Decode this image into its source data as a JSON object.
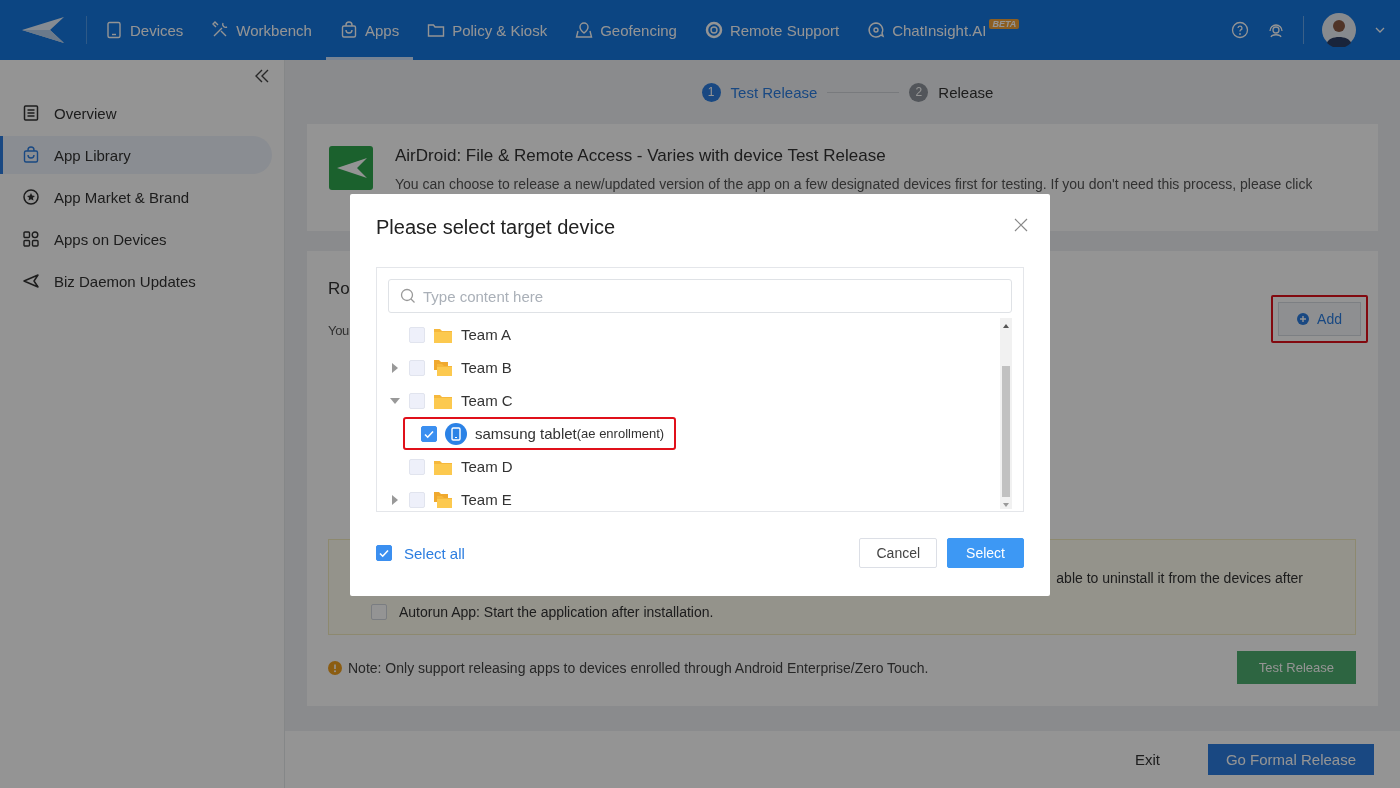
{
  "header": {
    "nav": [
      {
        "label": "Devices",
        "selected": false
      },
      {
        "label": "Workbench",
        "selected": false
      },
      {
        "label": "Apps",
        "selected": true
      },
      {
        "label": "Policy & Kiosk",
        "selected": false
      },
      {
        "label": "Geofencing",
        "selected": false
      },
      {
        "label": "Remote Support",
        "selected": false
      },
      {
        "label": "ChatInsight.AI",
        "selected": false,
        "badge": "BETA"
      }
    ]
  },
  "sidebar": {
    "items": [
      {
        "label": "Overview",
        "selected": false
      },
      {
        "label": "App Library",
        "selected": true
      },
      {
        "label": "App Market & Brand",
        "selected": false
      },
      {
        "label": "Apps on Devices",
        "selected": false
      },
      {
        "label": "Biz Daemon Updates",
        "selected": false
      }
    ]
  },
  "steps": [
    {
      "number": "1",
      "label": "Test Release",
      "selected": true
    },
    {
      "number": "2",
      "label": "Release",
      "selected": false
    }
  ],
  "app_card": {
    "title": "AirDroid: File & Remote Access - Varies with device Test Release",
    "description": "You can choose to release a new/updated version of the app on a few designated devices first for testing. If you don't need this process, please click"
  },
  "release_section": {
    "heading": "Ro",
    "text": "You",
    "add_button": {
      "label": "Add",
      "highlighted": true
    }
  },
  "options": {
    "uninstall_text": "able to uninstall it from the devices after",
    "autorun": {
      "label": "Autorun App: Start the application after installation.",
      "checked": false
    }
  },
  "note": "Note: Only support releasing apps to devices enrolled through Android Enterprise/Zero Touch.",
  "test_release_button": {
    "label": "Test Release",
    "disabled": true
  },
  "footer": {
    "exit": "Exit",
    "formal_release": "Go Formal Release"
  },
  "dialog": {
    "title": "Please select target device",
    "search": {
      "placeholder": "Type content here"
    },
    "tree": [
      {
        "kind": "folder",
        "label": "Team A",
        "expandable": false,
        "checked": false,
        "highlighted": false
      },
      {
        "kind": "folders",
        "label": "Team B",
        "expandable": true,
        "expanded": false,
        "checked": false,
        "highlighted": false
      },
      {
        "kind": "folder",
        "label": "Team C",
        "expandable": true,
        "expanded": true,
        "checked": false,
        "highlighted": false,
        "children": [
          {
            "kind": "device",
            "label": "samsung tablet",
            "note": "(ae enrollment)",
            "expandable": false,
            "checked": true,
            "highlighted": true
          }
        ]
      },
      {
        "kind": "folder",
        "label": "Team D",
        "expandable": false,
        "checked": false,
        "highlighted": false
      },
      {
        "kind": "folders",
        "label": "Team E",
        "expandable": true,
        "expanded": false,
        "checked": false,
        "highlighted": false
      }
    ],
    "select_all": {
      "label": "Select all",
      "checked": true
    },
    "buttons": [
      {
        "kind": "secondary",
        "label": "Cancel"
      },
      {
        "kind": "primary",
        "label": "Select"
      }
    ]
  }
}
